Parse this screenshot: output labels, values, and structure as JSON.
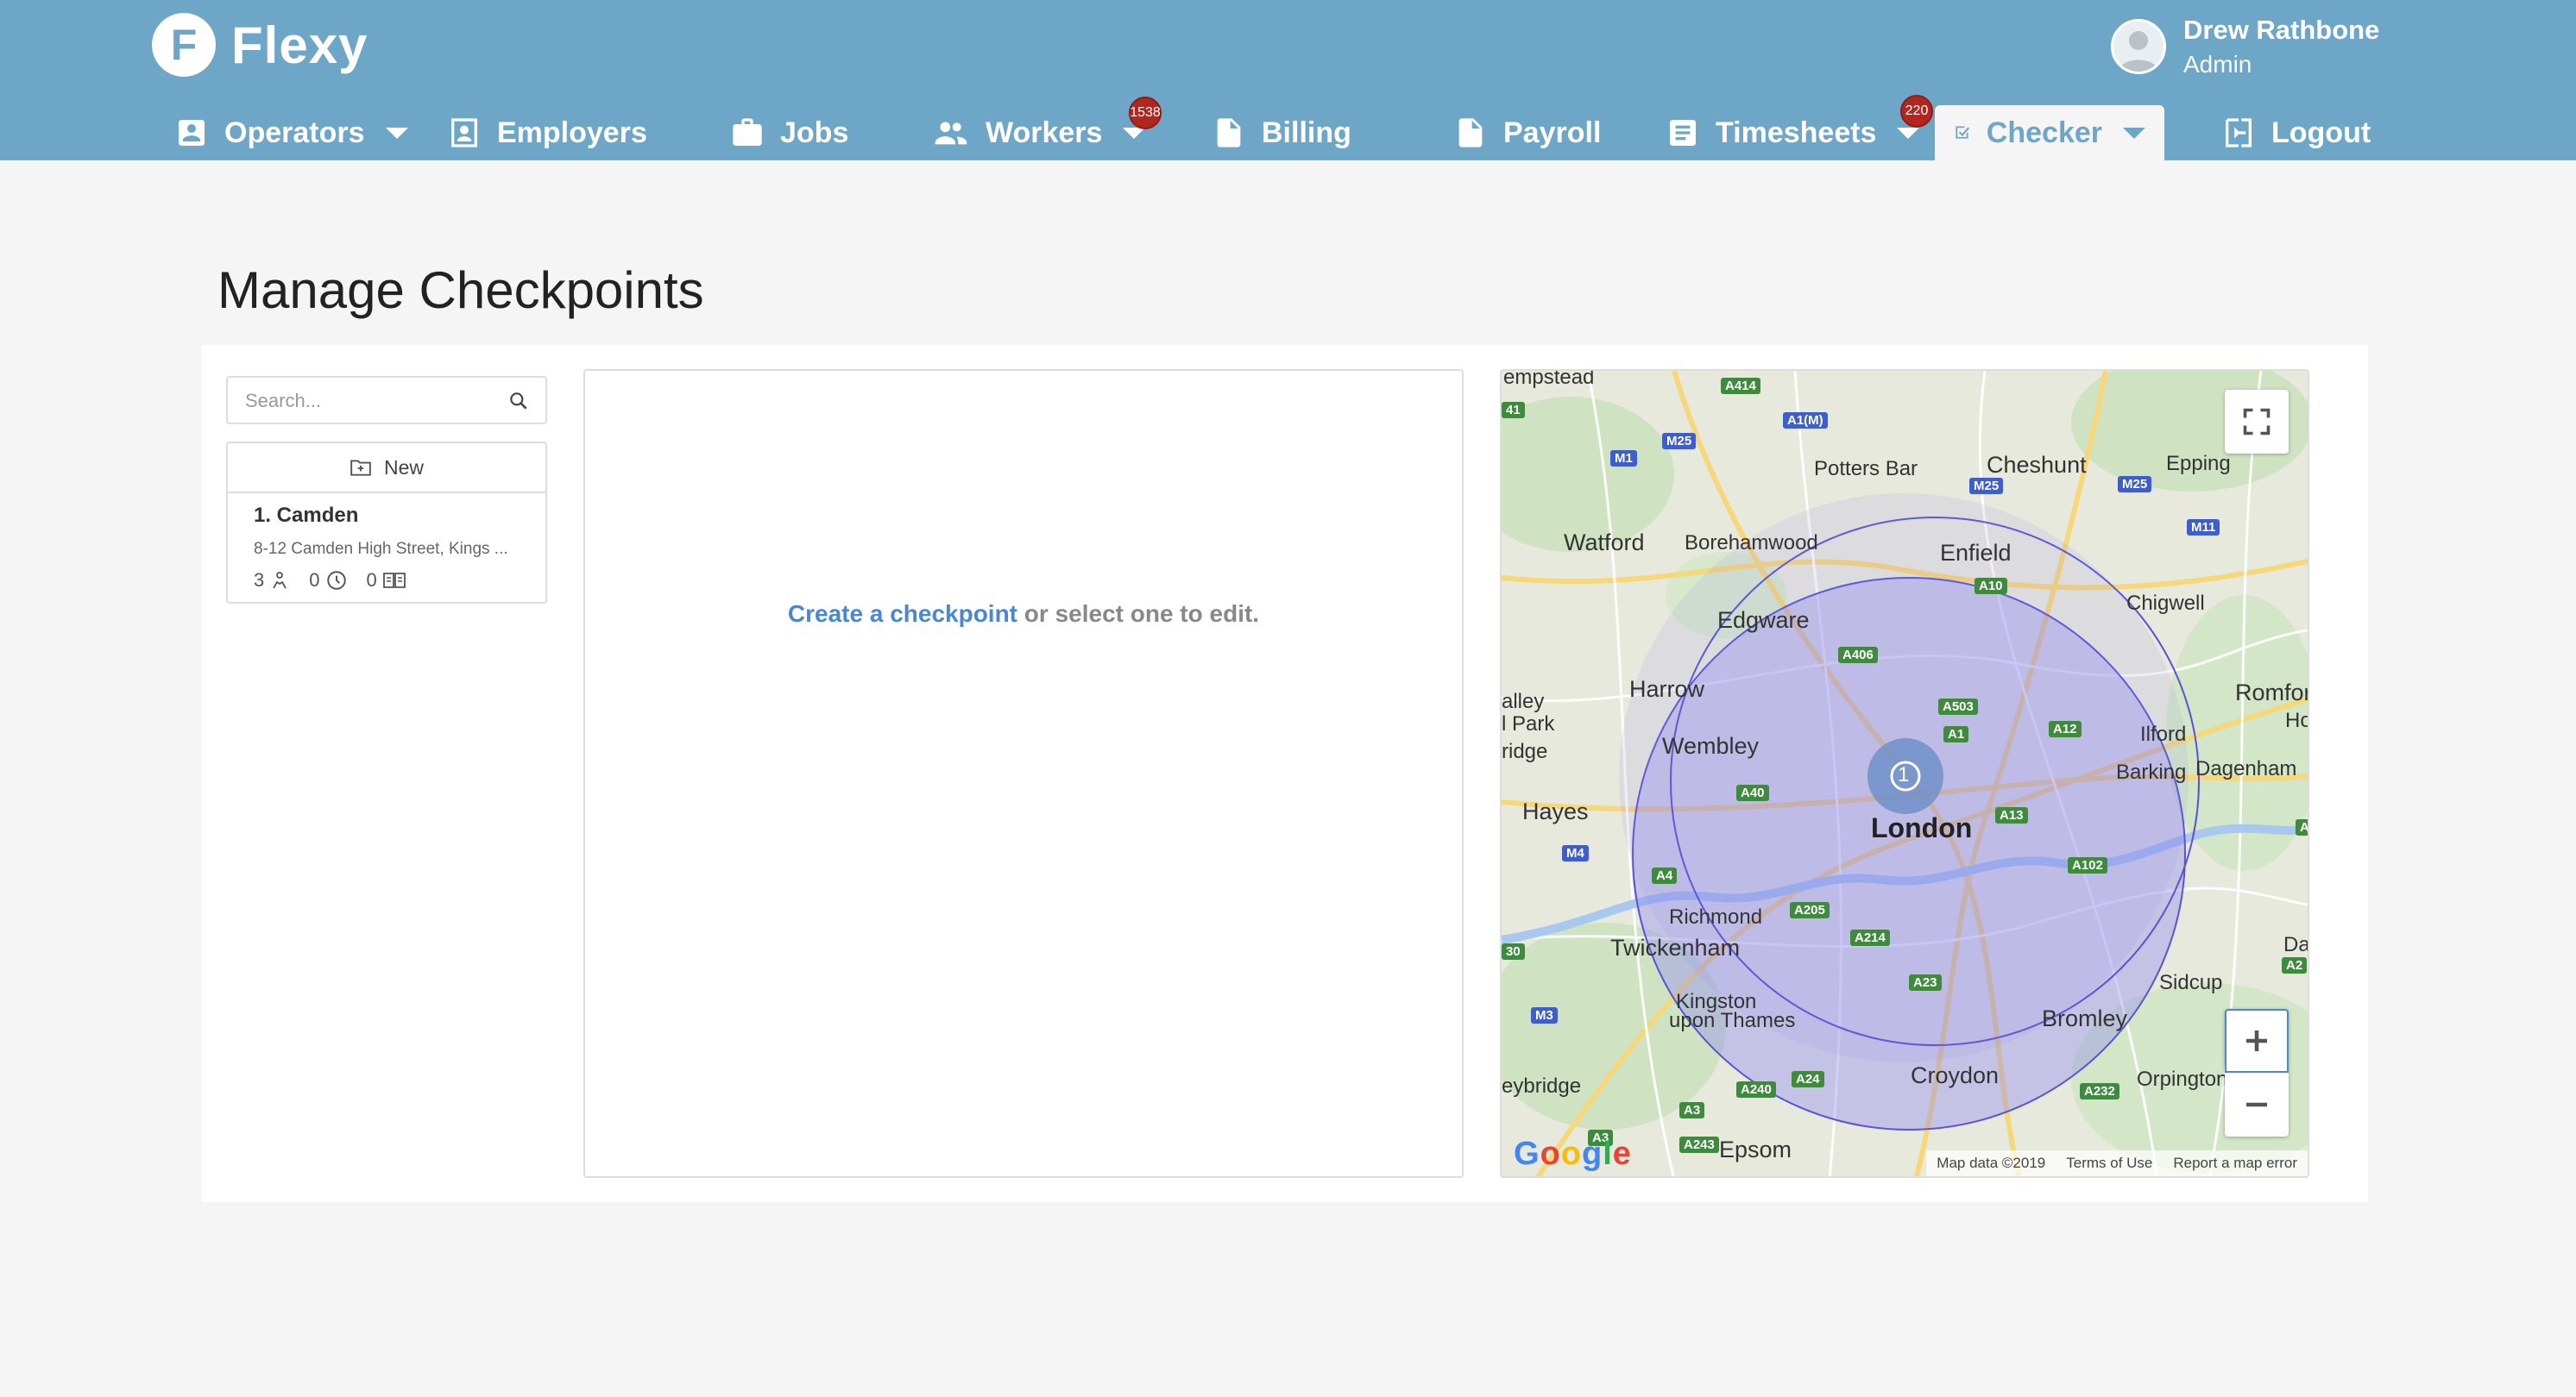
{
  "app": {
    "name": "Flexy",
    "logo_letter": "F"
  },
  "user": {
    "name": "Drew Rathbone",
    "role": "Admin"
  },
  "nav": [
    {
      "label": "Operators",
      "icon": "account-box-icon",
      "caret": true
    },
    {
      "label": "Employers",
      "icon": "contact-card-icon"
    },
    {
      "label": "Jobs",
      "icon": "briefcase-icon"
    },
    {
      "label": "Workers",
      "icon": "people-icon",
      "caret": true,
      "badge": "1538"
    },
    {
      "label": "Billing",
      "icon": "document-icon"
    },
    {
      "label": "Payroll",
      "icon": "document-icon"
    },
    {
      "label": "Timesheets",
      "icon": "list-document-icon",
      "caret": true,
      "badge": "220"
    },
    {
      "label": "Checker",
      "icon": "check-box-icon",
      "caret": true,
      "active": true
    },
    {
      "label": "Logout",
      "icon": "logout-icon"
    }
  ],
  "page": {
    "title": "Manage Checkpoints"
  },
  "search": {
    "placeholder": "Search..."
  },
  "list": {
    "new_label": "New",
    "items": [
      {
        "name": "1. Camden",
        "address": "8-12 Camden High Street, Kings ...",
        "workers": "3",
        "hours": "0",
        "logs": "0"
      }
    ]
  },
  "editor": {
    "link_text": "Create a checkpoint",
    "rest_text": " or select one to edit."
  },
  "map": {
    "labels": {
      "hempstead": "empstead",
      "potters_bar": "Potters Bar",
      "cheshunt": "Cheshunt",
      "epping": "Epping",
      "watford": "Watford",
      "borehamwood": "Borehamwood",
      "enfield": "Enfield",
      "chigwell": "Chigwell",
      "edgware": "Edgware",
      "harrow": "Harrow",
      "romford": "Romfor",
      "hornchurch": "Hor",
      "valley": "alley",
      "park": "l Park",
      "ridge": "ridge",
      "wembley": "Wembley",
      "ilford": "Ilford",
      "barking": "Barking",
      "dagenham": "Dagenham",
      "hayes": "Hayes",
      "london": "London",
      "richmond": "Richmond",
      "twickenham": "Twickenham",
      "da": "Da",
      "sidcup": "Sidcup",
      "kingston1": "Kingston",
      "kingston2": "upon Thames",
      "bromley": "Bromley",
      "croydon": "Croydon",
      "orpington": "Orpington",
      "weybridge": "eybridge",
      "epsom": "Epsom"
    },
    "roads": {
      "a414": "A414",
      "a1m": "A1(M)",
      "m25a": "M25",
      "m1": "M1",
      "a41": "41",
      "m25b": "M25",
      "m25c": "M25",
      "m11": "M11",
      "a10": "A10",
      "a406": "A406",
      "a503": "A503",
      "a1": "A1",
      "a12": "A12",
      "a40": "A40",
      "a13": "A13",
      "m4": "M4",
      "a4": "A4",
      "a102": "A102",
      "a205": "A205",
      "a214": "A214",
      "a30": "30",
      "a23": "A23",
      "a2": "A2",
      "m3": "M3",
      "a24": "A24",
      "a240": "A240",
      "a232": "A232",
      "a3": "A3",
      "a243": "A243",
      "a3b": "A3",
      "aa": "A"
    },
    "marker_count": "1",
    "footer": {
      "data": "Map data ©2019",
      "terms": "Terms of Use",
      "report": "Report a map error"
    },
    "google": "Google"
  }
}
